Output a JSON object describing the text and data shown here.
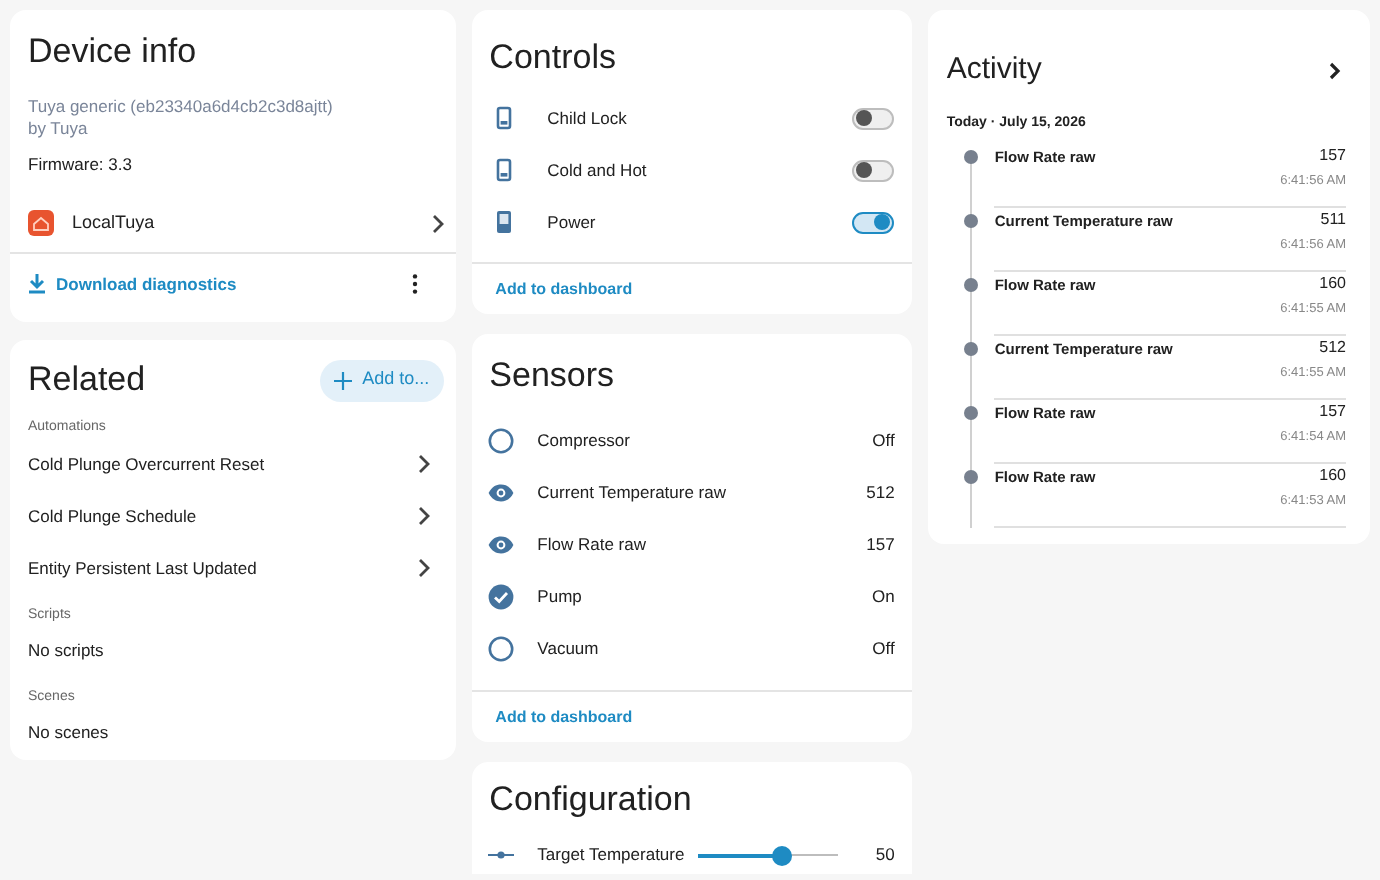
{
  "device_info": {
    "title": "Device info",
    "model": "Tuya generic (eb23340a6d4cb2c3d8ajtt)",
    "manufacturer": "by Tuya",
    "firmware": "Firmware: 3.3",
    "integration": "LocalTuya",
    "download": "Download diagnostics"
  },
  "related": {
    "title": "Related",
    "add_button": "Add to...",
    "sections": [
      {
        "heading": "Automations",
        "items": [
          {
            "label": "Cold Plunge Overcurrent Reset",
            "kind": "link"
          },
          {
            "label": "Cold Plunge Schedule",
            "kind": "link"
          },
          {
            "label": "Entity Persistent Last Updated",
            "kind": "link"
          }
        ]
      },
      {
        "heading": "Scripts",
        "items": [
          {
            "label": "No scripts",
            "kind": "empty"
          }
        ]
      },
      {
        "heading": "Scenes",
        "items": [
          {
            "label": "No scenes",
            "kind": "empty"
          }
        ]
      }
    ]
  },
  "controls": {
    "title": "Controls",
    "items": [
      {
        "label": "Child Lock",
        "on": false
      },
      {
        "label": "Cold and Hot",
        "on": false
      },
      {
        "label": "Power",
        "on": true
      }
    ],
    "add_link": "Add to dashboard"
  },
  "sensors": {
    "title": "Sensors",
    "items": [
      {
        "label": "Compressor",
        "kind": "binary",
        "on": false,
        "value": "Off"
      },
      {
        "label": "Current Temperature raw",
        "kind": "sensor",
        "value": "512"
      },
      {
        "label": "Flow Rate raw",
        "kind": "sensor",
        "value": "157"
      },
      {
        "label": "Pump",
        "kind": "binary",
        "on": true,
        "value": "On"
      },
      {
        "label": "Vacuum",
        "kind": "binary",
        "on": false,
        "value": "Off"
      }
    ],
    "add_link": "Add to dashboard"
  },
  "configuration": {
    "title": "Configuration",
    "items": [
      {
        "label": "Target Temperature",
        "level": 0.6,
        "value": "50"
      }
    ]
  },
  "activity": {
    "title": "Activity",
    "date": "Today · July 15, 2026",
    "entries": [
      {
        "name": "Flow Rate raw",
        "value": "157",
        "time": "6:41:56 AM"
      },
      {
        "name": "Current Temperature raw",
        "value": "511",
        "time": "6:41:56 AM"
      },
      {
        "name": "Flow Rate raw",
        "value": "160",
        "time": "6:41:55 AM"
      },
      {
        "name": "Current Temperature raw",
        "value": "512",
        "time": "6:41:55 AM"
      },
      {
        "name": "Flow Rate raw",
        "value": "157",
        "time": "6:41:54 AM"
      },
      {
        "name": "Flow Rate raw",
        "value": "160",
        "time": "6:41:53 AM"
      }
    ]
  }
}
